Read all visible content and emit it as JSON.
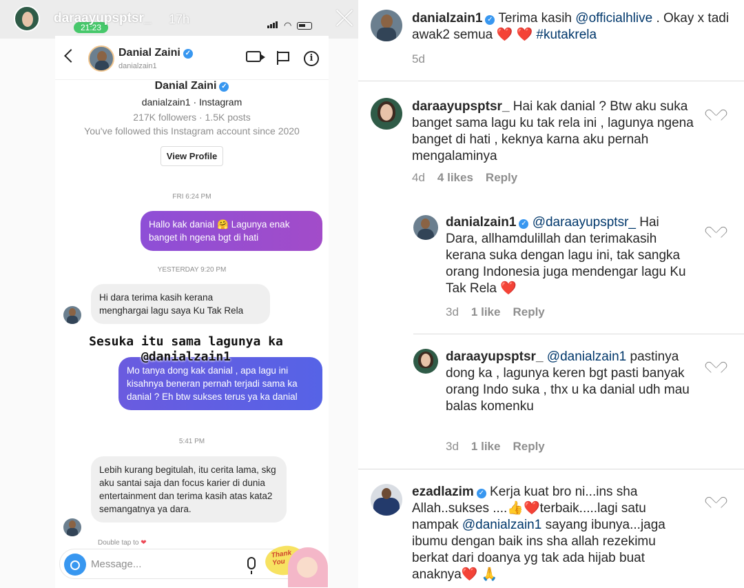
{
  "story": {
    "username": "daraayupsptsr_",
    "time_ago": "17h",
    "clock": "21:23"
  },
  "dm": {
    "name": "Danial Zaini",
    "handle": "danialzain1",
    "profile_sub": "danialzain1 · Instagram",
    "stats": "217K followers · 1.5K posts",
    "follow_note": "You've followed this Instagram account since 2020",
    "view_profile": "View Profile",
    "stamp1": "FRI 6:24 PM",
    "msg1": "Hallo kak danial 🤗 Lagunya enak banget ih ngena bgt di hati",
    "stamp2": "YESTERDAY 9:20 PM",
    "msg2": "Hi dara terima kasih kerana menghargai lagu saya Ku Tak Rela",
    "overlay": "Sesuka itu sama lagunya ka @danialzain1",
    "msg3": "Mo tanya dong kak danial , apa lagu ini kisahnya beneran pernah terjadi sama ka danial ? Eh btw sukses terus ya ka danial",
    "stamp3": "5:41 PM",
    "msg4": "Lebih kurang begitulah, itu cerita lama, skg aku santai saja dan focus karier di dunia entertainment dan terima kasih atas kata2 semangatnya ya dara.",
    "double_tap": "Double tap to",
    "message_placeholder": "Message...",
    "sticker_text": "Thank You"
  },
  "comments": {
    "c1": {
      "user": "danialzain1",
      "text_a": "Terima kasih ",
      "mention": "@officialhlive",
      "text_b": " . Okay x tadi awak2 semua ❤️ ❤️ ",
      "tag": "#kutakrela",
      "time": "5d"
    },
    "c2": {
      "user": "daraayupsptsr_",
      "text": "Hai kak danial ? Btw aku suka banget sama lagu ku tak rela ini , lagunya ngena banget di hati , keknya karna aku pernah mengalaminya",
      "time": "4d",
      "likes": "4 likes",
      "reply": "Reply"
    },
    "c3": {
      "user": "danialzain1",
      "mention": "@daraayupsptsr_",
      "text": " Hai Dara, allhamdulillah dan terimakasih kerana suka dengan lagu ini, tak sangka orang Indonesia juga mendengar lagu Ku Tak Rela ❤️",
      "time": "3d",
      "likes": "1 like",
      "reply": "Reply"
    },
    "c4": {
      "user": "daraayupsptsr_",
      "mention": "@danialzain1",
      "text": "pastinya dong ka , lagunya keren bgt pasti banyak orang Indo suka , thx u ka danial udh mau balas komenku",
      "time": "3d",
      "likes": "1 like",
      "reply": "Reply"
    },
    "c5": {
      "user": "ezadlazim",
      "text_a": " Kerja kuat bro ni...ins sha Allah..sukses ....👍❤️terbaik.....lagi satu nampak ",
      "mention": "@danialzain1",
      "text_b": " sayang ibunya...jaga ibumu dengan baik ins sha allah rezekimu berkat dari doanya yg tak ada hijab buat anaknya❤️ 🙏"
    }
  }
}
